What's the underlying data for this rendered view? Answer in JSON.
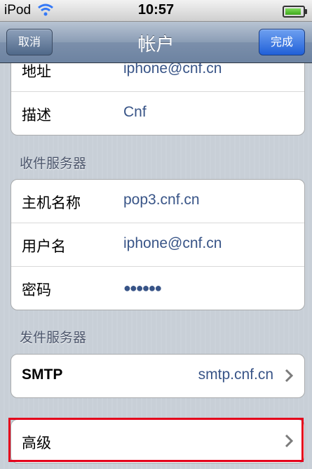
{
  "status_bar": {
    "carrier": "iPod",
    "time": "10:57"
  },
  "nav": {
    "title": "帐户",
    "cancel_label": "取消",
    "done_label": "完成"
  },
  "account_group": [
    {
      "label": "地址",
      "value": "iphone@cnf.cn"
    },
    {
      "label": "描述",
      "value": "Cnf"
    }
  ],
  "incoming": {
    "header": "收件服务器",
    "rows": [
      {
        "label": "主机名称",
        "value": "pop3.cnf.cn"
      },
      {
        "label": "用户名",
        "value": "iphone@cnf.cn"
      },
      {
        "label": "密码",
        "value": "●●●●●●"
      }
    ]
  },
  "outgoing": {
    "header": "发件服务器",
    "smtp_label": "SMTP",
    "smtp_value": "smtp.cnf.cn"
  },
  "advanced": {
    "label": "高级"
  },
  "colors": {
    "value_text": "#385487",
    "highlight": "#e4001b",
    "done_button": "#2060d8"
  }
}
